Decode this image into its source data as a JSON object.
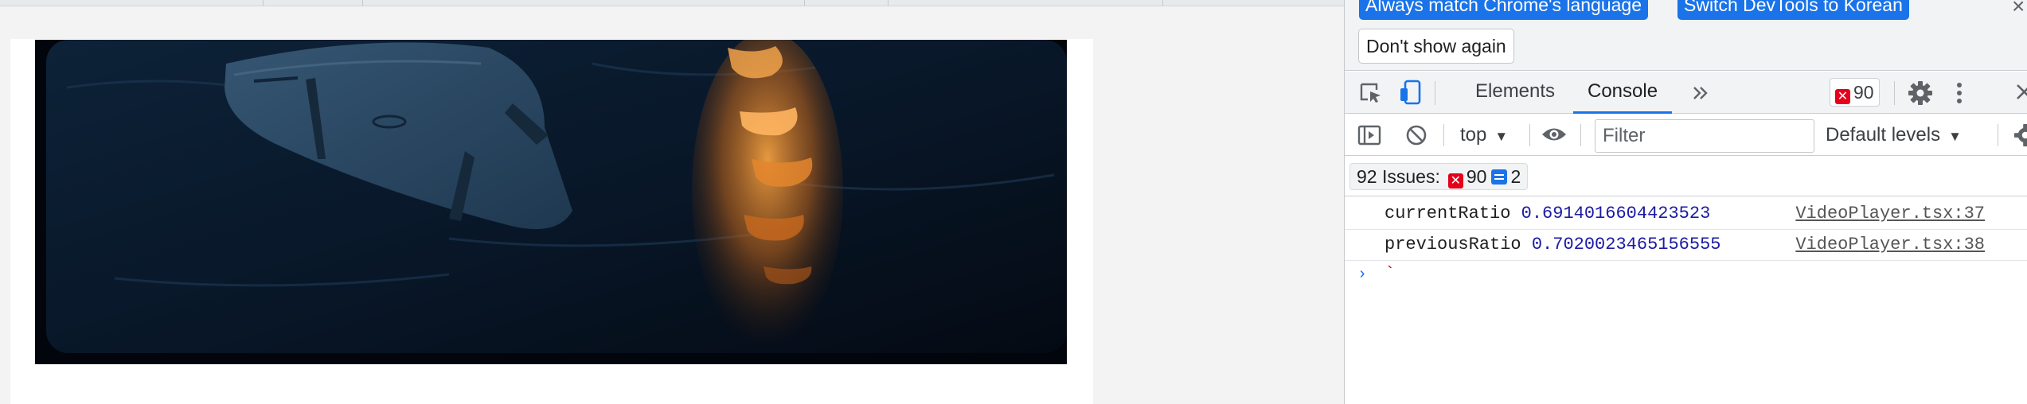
{
  "viewport": {
    "background": "#f3f3f3",
    "video": {
      "description_colors": {
        "water": "#0a1a2e",
        "reflection": "#e0882a",
        "surfboard": "#2c4a64"
      }
    }
  },
  "devtools": {
    "language_bar": {
      "match_language_label": "Always match Chrome's language",
      "switch_language_label": "Switch DevTools to Korean",
      "dont_show_label": "Don't show again"
    },
    "tabs": {
      "items": [
        {
          "label": "Elements",
          "active": false
        },
        {
          "label": "Console",
          "active": true
        }
      ],
      "more_icon": "double-chevron-icon",
      "error_count": "90"
    },
    "console_toolbar": {
      "context": "top",
      "filter_placeholder": "Filter",
      "filter_value": "",
      "levels": "Default levels"
    },
    "issues": {
      "label": "92 Issues:",
      "errors": "90",
      "info": "2"
    },
    "logs": [
      {
        "name": "currentRatio",
        "value": "0.6914016604423523",
        "source": "VideoPlayer.tsx:37"
      },
      {
        "name": "previousRatio",
        "value": "0.7020023465156555",
        "source": "VideoPlayer.tsx:38"
      }
    ],
    "prompt": {
      "symbol": "›",
      "input": "`"
    },
    "colors": {
      "accent": "#1a73e8",
      "error": "#e4001b",
      "number": "#1a1aa6"
    }
  }
}
